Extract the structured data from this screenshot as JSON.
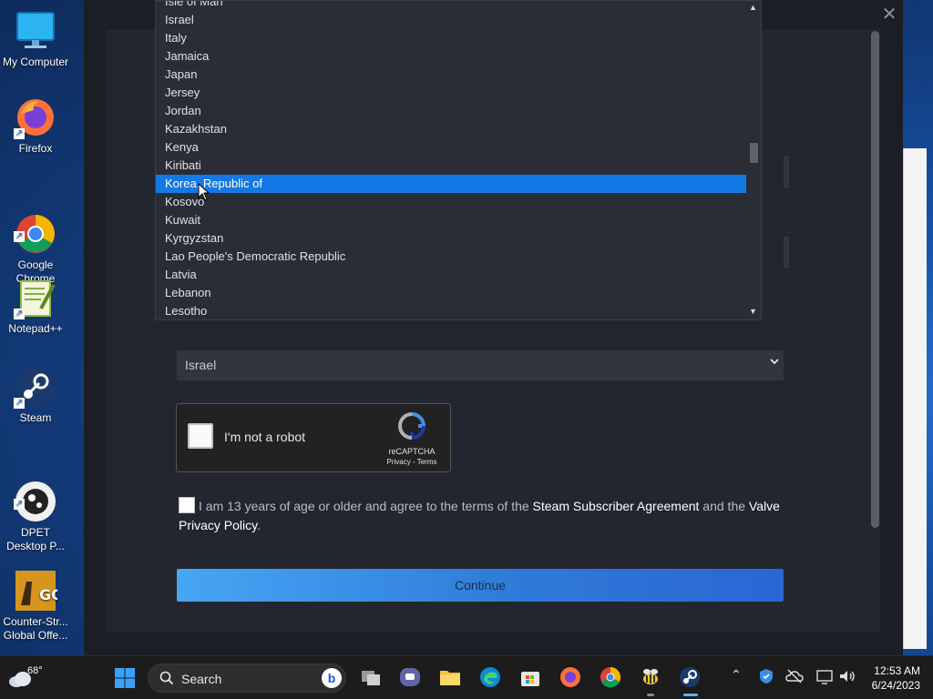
{
  "desktop": {
    "icons": [
      {
        "label": "My Computer",
        "icon": "monitor-icon"
      },
      {
        "label": "Firefox",
        "icon": "firefox-icon"
      },
      {
        "label": "Google\nChrome",
        "icon": "chrome-icon"
      },
      {
        "label": "Notepad++",
        "icon": "notepadpp-icon"
      },
      {
        "label": "Steam",
        "icon": "steam-icon"
      },
      {
        "label": "DPET\nDesktop P...",
        "icon": "dpet-icon"
      },
      {
        "label": "Counter-Str...\nGlobal Offe...",
        "icon": "csgo-icon"
      }
    ]
  },
  "dialog": {
    "close_glyph": "✕",
    "country_select": {
      "value": "Israel",
      "chevron": "⌄"
    },
    "dropdown": {
      "items": [
        "Isle of Man",
        "Israel",
        "Italy",
        "Jamaica",
        "Japan",
        "Jersey",
        "Jordan",
        "Kazakhstan",
        "Kenya",
        "Kiribati",
        "Korea, Republic of",
        "Kosovo",
        "Kuwait",
        "Kyrgyzstan",
        "Lao People's Democratic Republic",
        "Latvia",
        "Lebanon",
        "Lesotho"
      ],
      "highlighted": "Korea, Republic of",
      "scroll_up": "▲",
      "scroll_down": "▼"
    },
    "recaptcha": {
      "label": "I'm not a robot",
      "brand": "reCAPTCHA",
      "links": "Privacy - Terms"
    },
    "agreement": {
      "pre": "I am 13 years of age or older and agree to the terms of the ",
      "ssa": "Steam Subscriber Agreement",
      "mid": " and the ",
      "privacy": "Valve Privacy Policy",
      "end": "."
    },
    "continue_label": "Continue"
  },
  "taskbar": {
    "weather_temp": "68°",
    "search_label": "Search",
    "bing_glyph": "b",
    "tray_chevron": "⌃",
    "time": "12:53 AM",
    "date": "6/24/2023"
  },
  "colors": {
    "accent_blue": "#1479e6",
    "button_gradient_start": "#47a6f5",
    "dialog_bg": "#1b1e24"
  }
}
